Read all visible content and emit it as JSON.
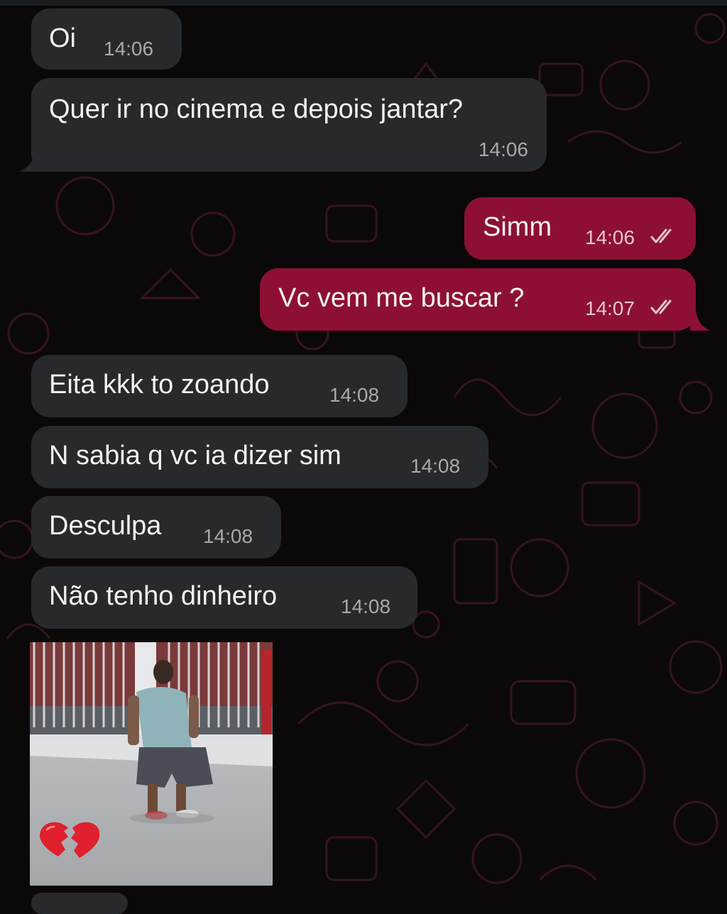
{
  "messages": [
    {
      "id": "oi",
      "text": "Oi",
      "time": "14:06",
      "direction": "incoming"
    },
    {
      "id": "cinema",
      "text": "Quer ir no cinema e depois jantar?",
      "time": "14:06",
      "direction": "incoming"
    },
    {
      "id": "simm",
      "text": "Simm",
      "time": "14:06",
      "direction": "outgoing",
      "status": "read"
    },
    {
      "id": "buscar",
      "text": "Vc vem me buscar ?",
      "time": "14:07",
      "direction": "outgoing",
      "status": "read"
    },
    {
      "id": "eita",
      "text": "Eita kkk to zoando",
      "time": "14:08",
      "direction": "incoming"
    },
    {
      "id": "sabia",
      "text": "N sabia q vc ia dizer sim",
      "time": "14:08",
      "direction": "incoming"
    },
    {
      "id": "desculpa",
      "text": "Desculpa",
      "time": "14:08",
      "direction": "incoming"
    },
    {
      "id": "dinheiro",
      "text": "Não tenho dinheiro",
      "time": "14:08",
      "direction": "incoming"
    }
  ],
  "media": {
    "type": "image",
    "sticker": "broken-heart-emoji"
  },
  "colors": {
    "background": "#0b0809",
    "incoming_bubble": "#28292c",
    "outgoing_bubble": "#8d1034",
    "timestamp": "#a9a9ad",
    "read_ticks": "#e6c4cf"
  }
}
